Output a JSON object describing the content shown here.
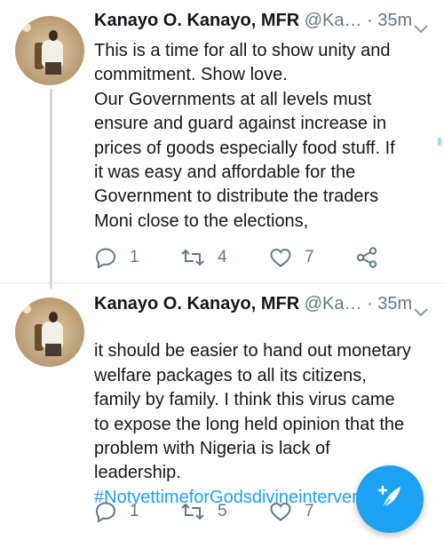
{
  "tweets": [
    {
      "name": "Kanayo O. Kanayo, MFR",
      "handle": "@Ka…",
      "separator": "·",
      "time": "35m",
      "text": "This is a time for all to show unity and\ncommitment. Show love.\nOur Governments at all levels must\nensure and guard against increase in\nprices of goods especially food stuff. If\nit was easy and affordable for the\nGovernment to distribute the traders\nMoni close to the elections,",
      "hashtag": "",
      "replies": "1",
      "retweets": "4",
      "likes": "7"
    },
    {
      "name": "Kanayo O. Kanayo, MFR",
      "handle": "@Ka…",
      "separator": "·",
      "time": "35m",
      "text": "it should be easier to hand out monetary\nwelfare packages to all its citizens,\nfamily by family. I think this virus came\nto expose the long held opinion that the\nproblem with Nigeria is lack of\nleadership.",
      "hashtag": "#NotyettimeforGodsdivineinterventio",
      "replies": "1",
      "retweets": "5",
      "likes": "7"
    }
  ],
  "icons": {
    "reply": "reply-icon",
    "retweet": "retweet-icon",
    "like": "heart-icon",
    "share": "share-icon",
    "caret": "chevron-down-icon",
    "compose": "compose-tweet-icon"
  },
  "colors": {
    "accent": "#1da1f2",
    "muted": "#657786",
    "text": "#14171a"
  }
}
